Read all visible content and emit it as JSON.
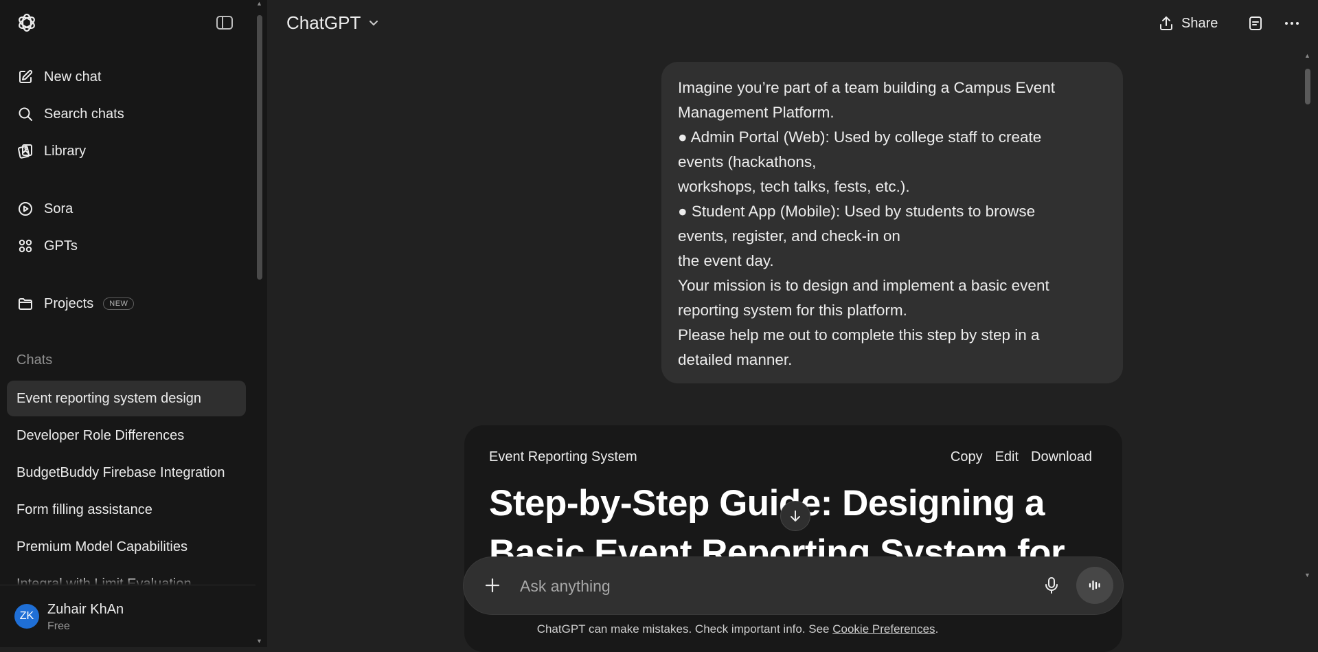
{
  "sidebar": {
    "nav": [
      {
        "label": "New chat",
        "icon": "edit-icon"
      },
      {
        "label": "Search chats",
        "icon": "search-icon"
      },
      {
        "label": "Library",
        "icon": "library-icon"
      },
      {
        "label": "Sora",
        "icon": "play-icon"
      },
      {
        "label": "GPTs",
        "icon": "grid-icon"
      },
      {
        "label": "Projects",
        "icon": "folder-icon"
      }
    ],
    "projects_badge": "NEW",
    "chats_header": "Chats",
    "chats": [
      "Event reporting system design",
      "Developer Role Differences",
      "BudgetBuddy Firebase Integration",
      "Form filling assistance",
      "Premium Model Capabilities",
      "Integral with Limit Evaluation"
    ],
    "user": {
      "initials": "ZK",
      "name": "Zuhair KhAn",
      "plan": "Free"
    }
  },
  "header": {
    "model": "ChatGPT",
    "share_label": "Share"
  },
  "conversation": {
    "user_message_lines": [
      "Imagine you’re part of a team building a Campus Event",
      "Management Platform.",
      "● Admin Portal (Web): Used by college staff to create",
      "events (hackathons,",
      "workshops, tech talks, fests, etc.).",
      "● Student App (Mobile): Used by students to browse",
      "events, register, and check-in on",
      "the event day.",
      "Your mission is to design and implement a basic event",
      "reporting system for this platform.",
      "Please help me out to complete this step by step in a",
      "detailed manner."
    ],
    "canvas": {
      "title": "Event Reporting System",
      "actions": [
        "Copy",
        "Edit",
        "Download"
      ],
      "heading_line1": "Step-by-Step Guide: Designing a",
      "heading_line2": "Basic Event Reporting System for"
    }
  },
  "composer": {
    "placeholder": "Ask anything"
  },
  "footer": {
    "text": "ChatGPT can make mistakes. Check important info. See ",
    "link": "Cookie Preferences",
    "end": "."
  },
  "colors": {
    "background": "#212121",
    "sidebar": "#171717",
    "bubble": "#303030",
    "avatar": "#1f6fd6"
  }
}
